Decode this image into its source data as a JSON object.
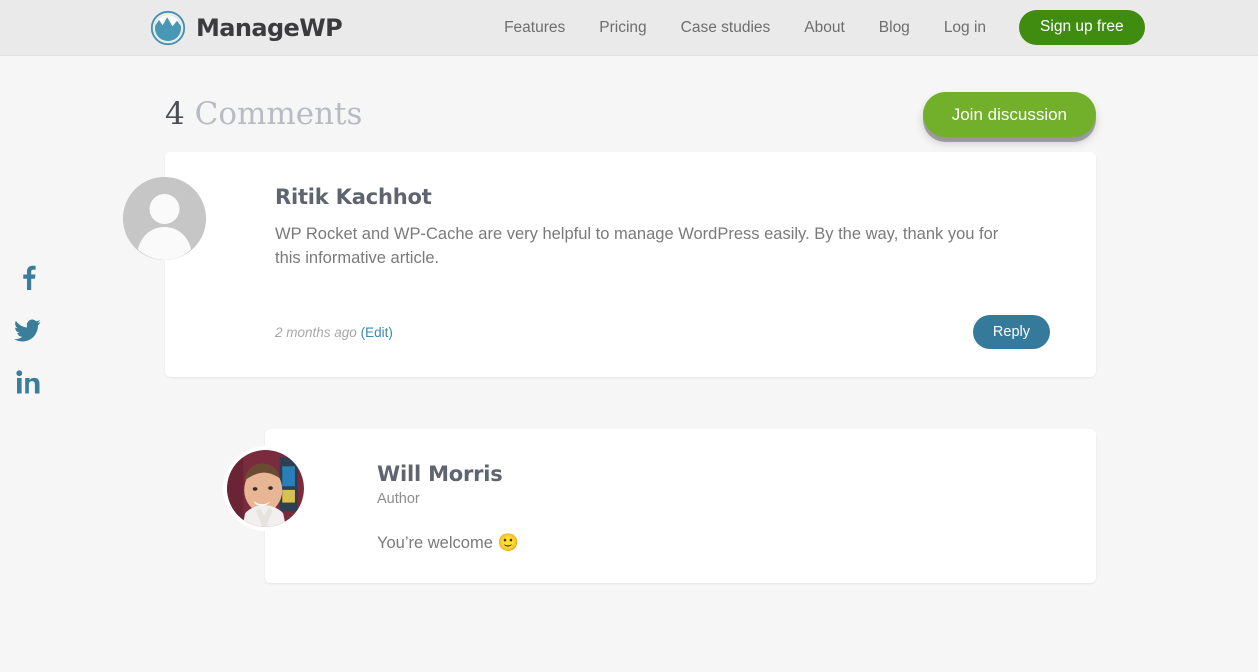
{
  "header": {
    "brand": {
      "name": "ManageWP",
      "logo_icon": "mountain-circle-logo",
      "logo_color": "#3f91b2"
    },
    "nav": [
      {
        "label": "Features"
      },
      {
        "label": "Pricing"
      },
      {
        "label": "Case studies"
      },
      {
        "label": "About"
      },
      {
        "label": "Blog"
      },
      {
        "label": "Log in"
      }
    ],
    "cta": {
      "label": "Sign up free",
      "color": "#3f8c10"
    }
  },
  "social": [
    {
      "icon": "facebook-icon",
      "label": "Facebook"
    },
    {
      "icon": "twitter-icon",
      "label": "Twitter"
    },
    {
      "icon": "linkedin-icon",
      "label": "LinkedIn"
    }
  ],
  "comments_section": {
    "count": "4",
    "title": "Comments",
    "join_button": {
      "label": "Join discussion",
      "color": "#72b02c"
    }
  },
  "comments": [
    {
      "author": "Ritik Kachhot",
      "role": "",
      "avatar": "placeholder-avatar",
      "body": "WP Rocket and WP-Cache are very helpful to manage WordPress easily. By the way, thank you for this informative article.",
      "timestamp": "2 months ago",
      "edit_label": "(Edit)",
      "reply_label": "Reply"
    },
    {
      "author": "Will Morris",
      "role": "Author",
      "avatar": "photo-avatar",
      "body": "You’re welcome ",
      "emoji": "🙂",
      "timestamp": "",
      "edit_label": "",
      "reply_label": ""
    }
  ]
}
